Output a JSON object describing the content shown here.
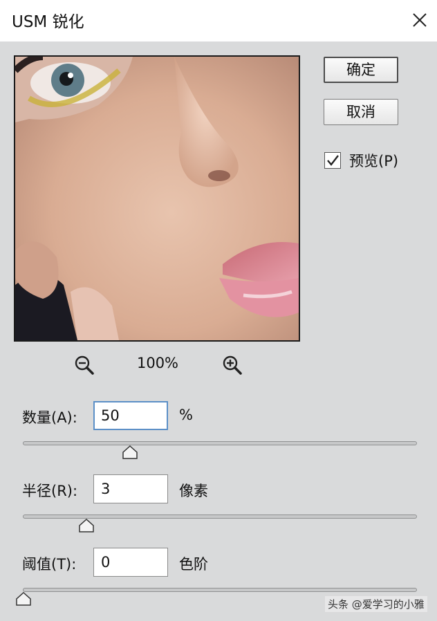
{
  "window": {
    "title": "USM 锐化",
    "close_icon": "close-icon"
  },
  "buttons": {
    "ok_label": "确定",
    "cancel_label": "取消"
  },
  "preview_toggle": {
    "label": "预览(P)",
    "checked": true
  },
  "zoom": {
    "level": "100%",
    "zoom_out_icon": "zoom-out-icon",
    "zoom_in_icon": "zoom-in-icon"
  },
  "amount": {
    "label": "数量(A):",
    "value": "50",
    "unit": "%",
    "slider_fraction": 0.27
  },
  "radius": {
    "label": "半径(R):",
    "value": "3",
    "unit": "像素",
    "slider_fraction": 0.16
  },
  "threshold": {
    "label": "阈值(T):",
    "value": "0",
    "unit": "色阶",
    "slider_fraction": 0.0
  },
  "watermark": "头条 @爱学习的小雅"
}
